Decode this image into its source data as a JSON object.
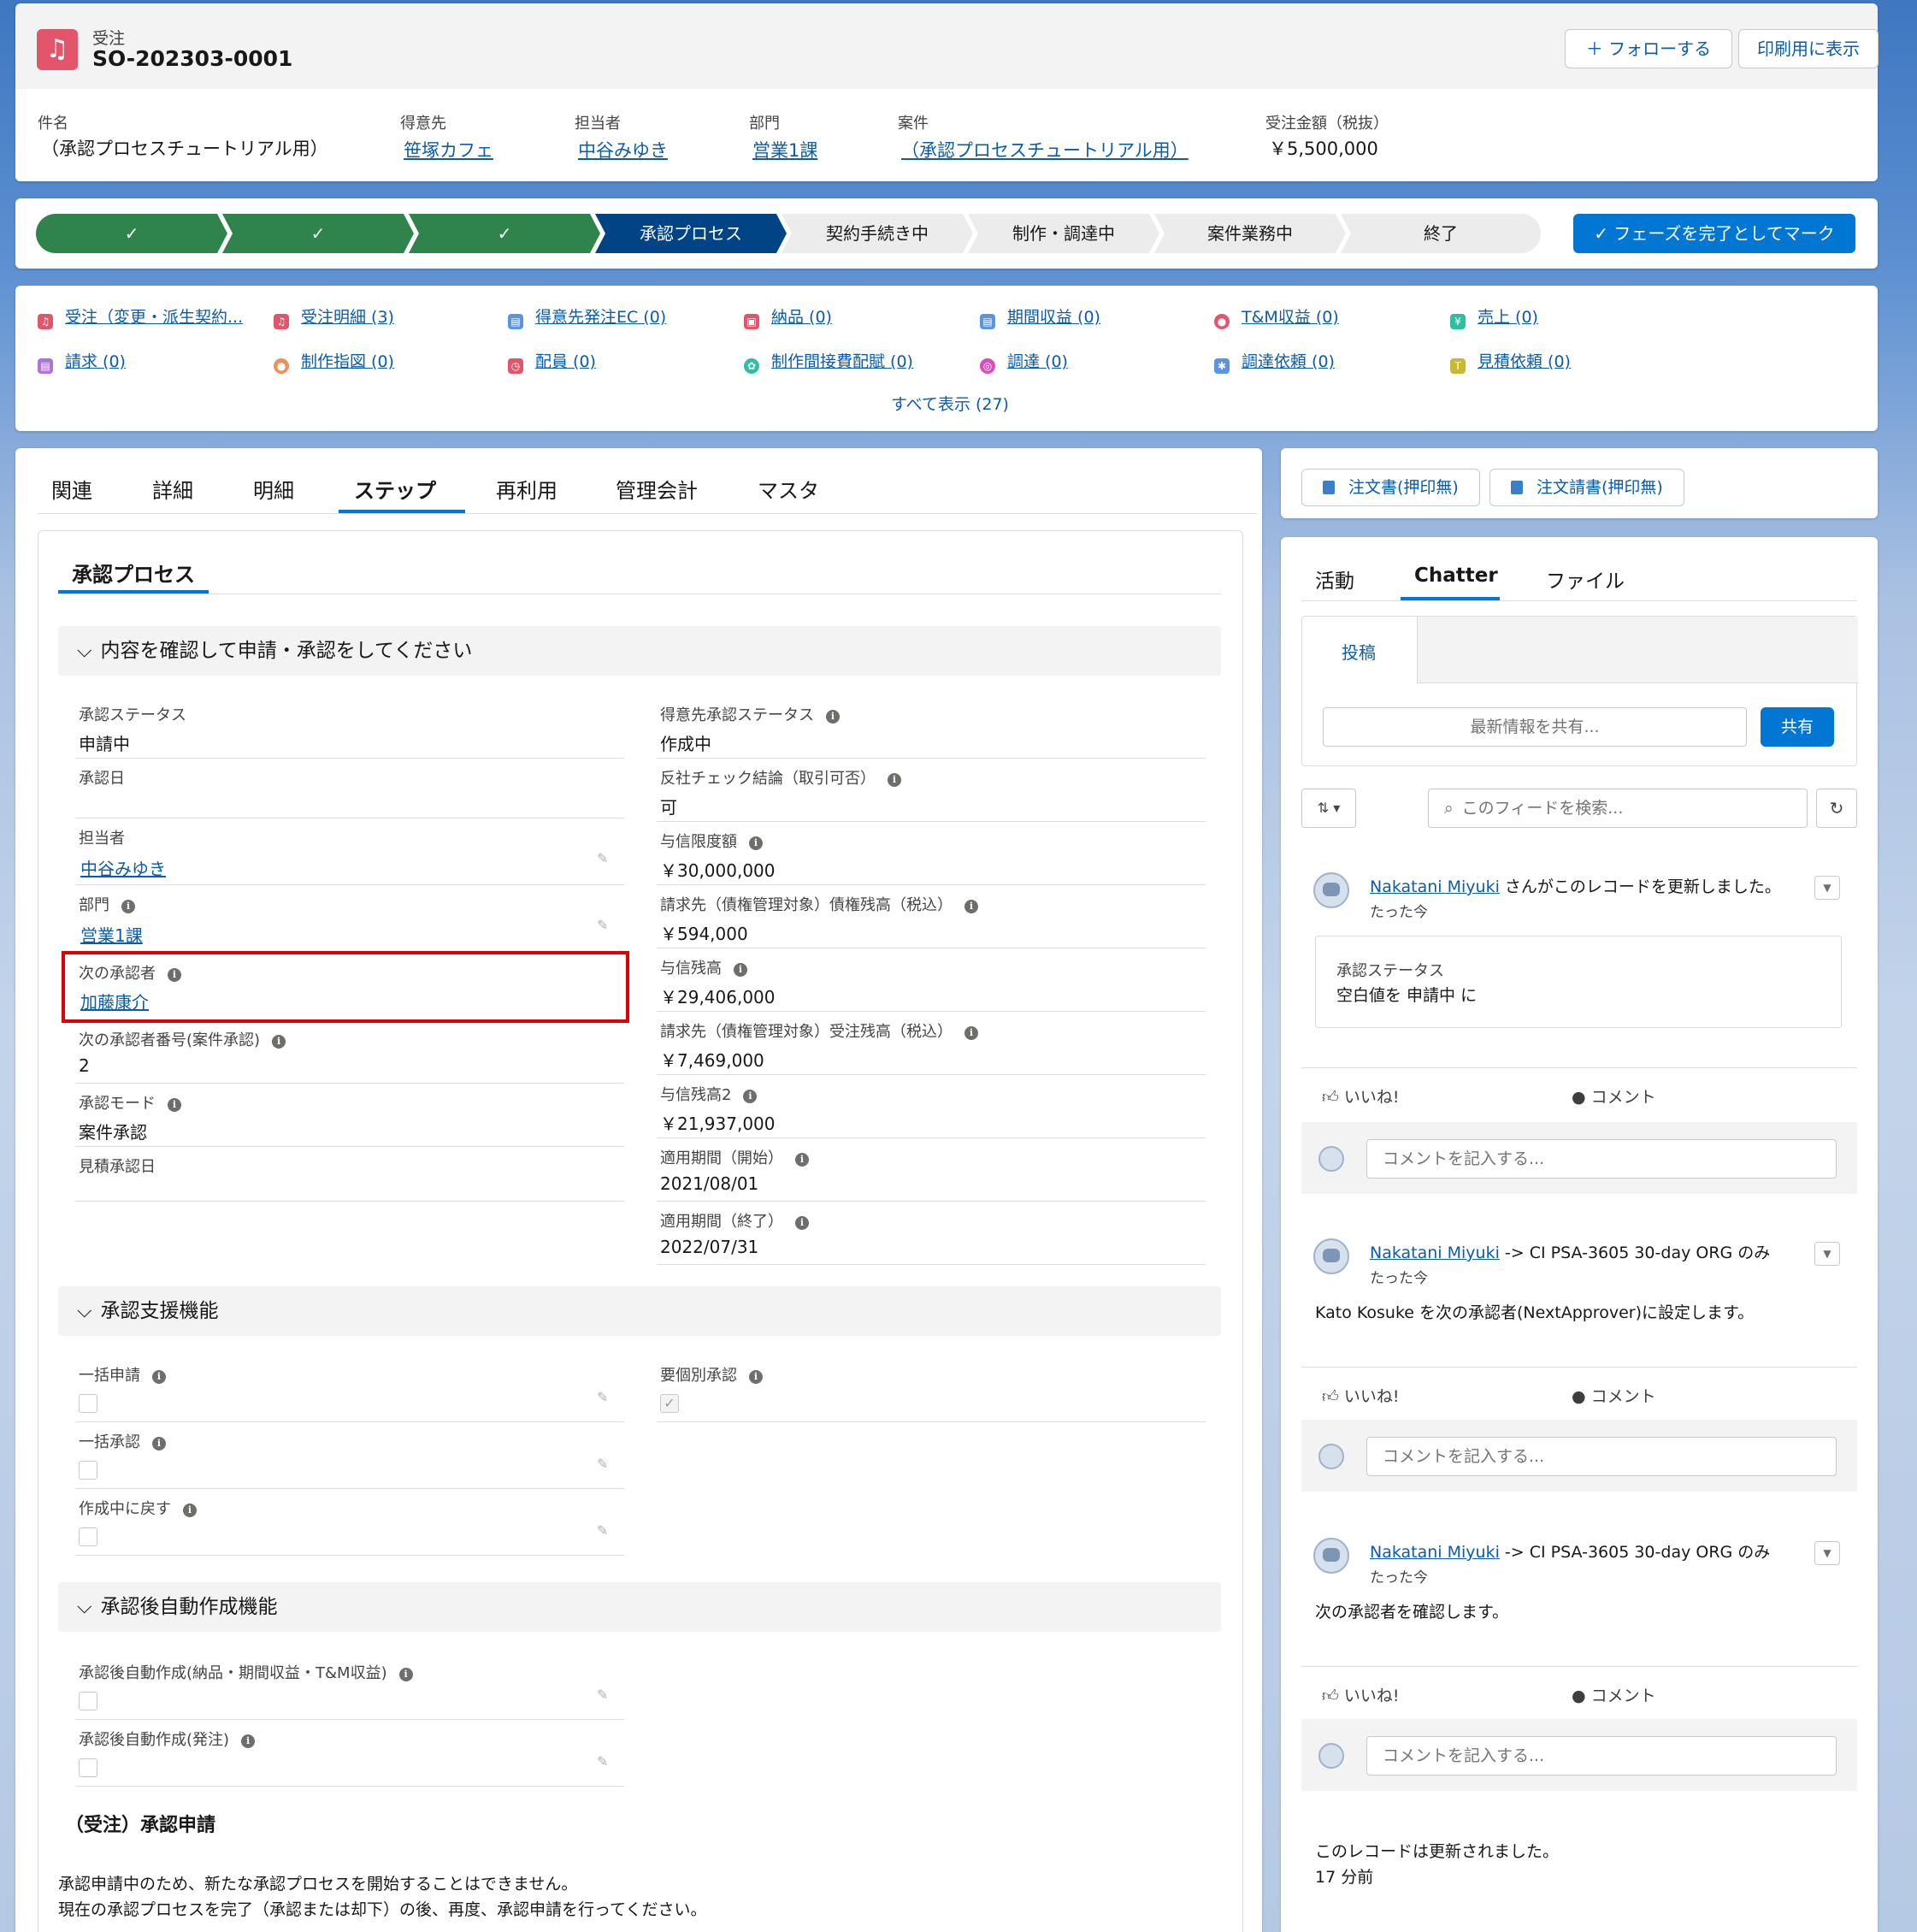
{
  "header": {
    "object_type": "受注",
    "record_name": "SO-202303-0001",
    "follow_label": "＋ フォローする",
    "print_label": "印刷用に表示",
    "fields": [
      {
        "label": "件名",
        "value": "（承認プロセスチュートリアル用）"
      },
      {
        "label": "得意先",
        "value": "笹塚カフェ"
      },
      {
        "label": "担当者",
        "value": "中谷みゆき"
      },
      {
        "label": "部門",
        "value": "営業1課"
      },
      {
        "label": "案件",
        "value": "（承認プロセスチュートリアル用）"
      },
      {
        "label": "受注金額（税抜）",
        "value": "￥5,500,000"
      }
    ]
  },
  "path": {
    "stages": [
      "✓",
      "✓",
      "✓",
      "承認プロセス",
      "契約手続き中",
      "制作・調達中",
      "案件業務中",
      "終了"
    ],
    "complete_label": "✓ フェーズを完了としてマーク"
  },
  "related": {
    "items": [
      {
        "label": "受注（変更・派生契約...",
        "color": "#e3556b"
      },
      {
        "label": "受注明細 (3)",
        "color": "#e3556b"
      },
      {
        "label": "得意先発注EC (0)",
        "color": "#5a95dd"
      },
      {
        "label": "納品 (0)",
        "color": "#e3556b"
      },
      {
        "label": "期間収益 (0)",
        "color": "#5a95dd"
      },
      {
        "label": "T&M収益 (0)",
        "color": "#e3556b"
      },
      {
        "label": "売上 (0)",
        "color": "#2fbfa0"
      },
      {
        "label": "請求 (0)",
        "color": "#b073d9"
      },
      {
        "label": "制作指図 (0)",
        "color": "#e8935a"
      },
      {
        "label": "配員 (0)",
        "color": "#e3556b"
      },
      {
        "label": "制作間接費配賦 (0)",
        "color": "#2fbfa0"
      },
      {
        "label": "調達 (0)",
        "color": "#d64fc1"
      },
      {
        "label": "調達依頼 (0)",
        "color": "#5a95dd"
      },
      {
        "label": "見積依頼 (0)",
        "color": "#c9b834"
      }
    ],
    "view_all": "すべて表示 (27)"
  },
  "tabs": [
    "関連",
    "詳細",
    "明細",
    "ステップ",
    "再利用",
    "管理会計",
    "マスタ"
  ],
  "main": {
    "subtab": "承認プロセス",
    "section1_title": "内容を確認して申請・承認をしてください",
    "left_fields": [
      {
        "label": "承認ステータス",
        "value": "申請中"
      },
      {
        "label": "承認日",
        "value": ""
      },
      {
        "label": "担当者",
        "value": "中谷みゆき"
      },
      {
        "label": "部門",
        "value": "営業1課"
      },
      {
        "label": "次の承認者",
        "value": "加藤康介"
      },
      {
        "label": "次の承認者番号(案件承認)",
        "value": "2"
      },
      {
        "label": "承認モード",
        "value": "案件承認"
      },
      {
        "label": "見積承認日",
        "value": ""
      }
    ],
    "right_fields": [
      {
        "label": "得意先承認ステータス",
        "value": "作成中"
      },
      {
        "label": "反社チェック結論（取引可否）",
        "value": "可"
      },
      {
        "label": "与信限度額",
        "value": "￥30,000,000"
      },
      {
        "label": "請求先（債権管理対象）債権残高（税込）",
        "value": "￥594,000"
      },
      {
        "label": "与信残高",
        "value": "￥29,406,000"
      },
      {
        "label": "請求先（債権管理対象）受注残高（税込）",
        "value": "￥7,469,000"
      },
      {
        "label": "与信残高2",
        "value": "￥21,937,000"
      },
      {
        "label": "適用期間（開始）",
        "value": "2021/08/01"
      },
      {
        "label": "適用期間（終了）",
        "value": "2022/07/31"
      }
    ],
    "section2_title": "承認支援機能",
    "support_fields": [
      "一括申請",
      "一括承認",
      "作成中に戻す"
    ],
    "support_right": "要個別承認",
    "section3_title": "承認後自動作成機能",
    "auto_fields": [
      "承認後自動作成(納品・期間収益・T&M収益)",
      "承認後自動作成(発注)"
    ],
    "apply_title": "（受注）承認申請",
    "apply_msg1": "承認申請中のため、新たな承認プロセスを開始することはできません。",
    "apply_msg2": "現在の承認プロセスを完了（承認または却下）の後、再度、承認申請を行ってください。"
  },
  "right": {
    "btn1": "注文書(押印無)",
    "btn2": "注文請書(押印無)",
    "tabs": [
      "活動",
      "Chatter",
      "ファイル"
    ],
    "post_tab": "投稿",
    "share_placeholder": "最新情報を共有...",
    "share_btn": "共有",
    "sort_icon": "⇅ ▾",
    "search_placeholder": "このフィードを検索...",
    "like": "いいね!",
    "comment": "コメント",
    "comment_placeholder": "コメントを記入する...",
    "posts": [
      {
        "author": "Nakatani Miyuki",
        "suffix": "さんがこのレコードを更新しました。",
        "time": "たった今",
        "body_label": "承認ステータス",
        "body": "空白値を 申請中 に"
      },
      {
        "author": "Nakatani Miyuki",
        "suffix": "-> CI PSA-3605 30-day ORG のみ",
        "time": "たった今",
        "body": "Kato Kosuke を次の承認者(NextApprover)に設定します。"
      },
      {
        "author": "Nakatani Miyuki",
        "suffix": "-> CI PSA-3605 30-day ORG のみ",
        "time": "たった今",
        "body": "次の承認者を確認します。"
      }
    ],
    "footer_msg": "このレコードは更新されました。",
    "footer_time": "17 分前"
  },
  "colors": {
    "brand": "#0176d3",
    "done": "#2e844a",
    "current": "#014486",
    "highlight": "#e00000"
  }
}
